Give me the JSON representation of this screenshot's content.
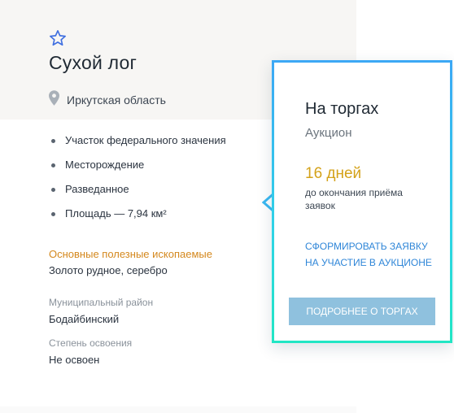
{
  "object": {
    "title": "Сухой лог",
    "region": "Иркутская область",
    "features": [
      "Участок федерального значения",
      "Месторождение",
      "Разведанное",
      "Площадь — 7,94 км²"
    ],
    "minerals": {
      "label": "Основные полезные ископаемые",
      "value": "Золото рудное, серебро"
    },
    "municipality": {
      "label": "Муниципальный район",
      "value": "Бодайбинский"
    },
    "development": {
      "label": "Степень освоения",
      "value": "Не освоен"
    }
  },
  "popup": {
    "title": "На торгах",
    "subtitle": "Аукцион",
    "days": "16 дней",
    "days_note": "до окончания приёма заявок",
    "apply_link": "Сформировать заявку на участие в аукционе",
    "details_button": "Подробнее о торгах"
  },
  "icons": {
    "favorite": "star-icon",
    "location": "map-pin-icon"
  },
  "colors": {
    "accent_orange": "#d4881e",
    "days_gold": "#d4a21a",
    "link_blue": "#2f86d8",
    "button_blue": "#8fc1de",
    "popup_border_top": "#3ca8f5",
    "popup_border_bottom": "#22e6c4",
    "star_blue": "#3f6fe0"
  }
}
